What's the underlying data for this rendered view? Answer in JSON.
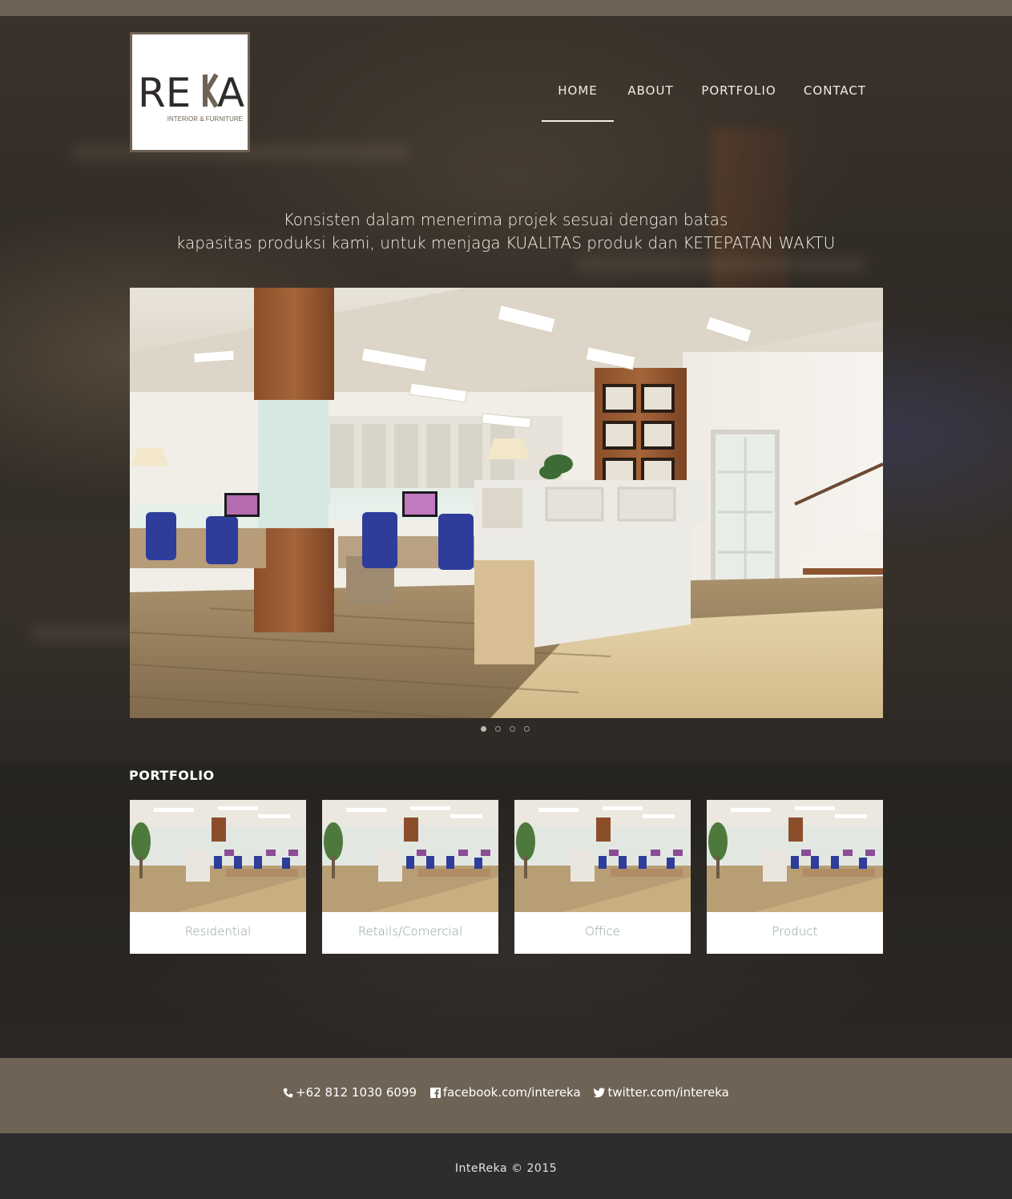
{
  "logo": {
    "wordmark": "REKA",
    "subtitle": "INTERIOR & FURNITURE"
  },
  "nav": {
    "items": [
      {
        "label": "HOME",
        "active": true
      },
      {
        "label": "ABOUT",
        "active": false
      },
      {
        "label": "PORTFOLIO",
        "active": false
      },
      {
        "label": "CONTACT",
        "active": false
      }
    ]
  },
  "tagline": {
    "line1": "Konsisten dalam menerima projek sesuai dengan batas",
    "line2": "kapasitas produksi kami, untuk menjaga KUALITAS produk dan KETEPATAN WAKTU"
  },
  "slider": {
    "slide_count": 4,
    "active_index": 0
  },
  "portfolio": {
    "title": "PORTFOLIO",
    "cards": [
      {
        "label": "Residential"
      },
      {
        "label": "Retails/Comercial"
      },
      {
        "label": "Office"
      },
      {
        "label": "Product"
      }
    ]
  },
  "contact": {
    "phone": "+62 812 1030 6099",
    "facebook": "facebook.com/intereka",
    "twitter": "twitter.com/intereka"
  },
  "footer": {
    "copyright": "InteReka © 2015"
  },
  "colors": {
    "brand_brown": "#6f6355",
    "dark_bg": "#2d2d2d",
    "card_label": "#8aa09a"
  }
}
